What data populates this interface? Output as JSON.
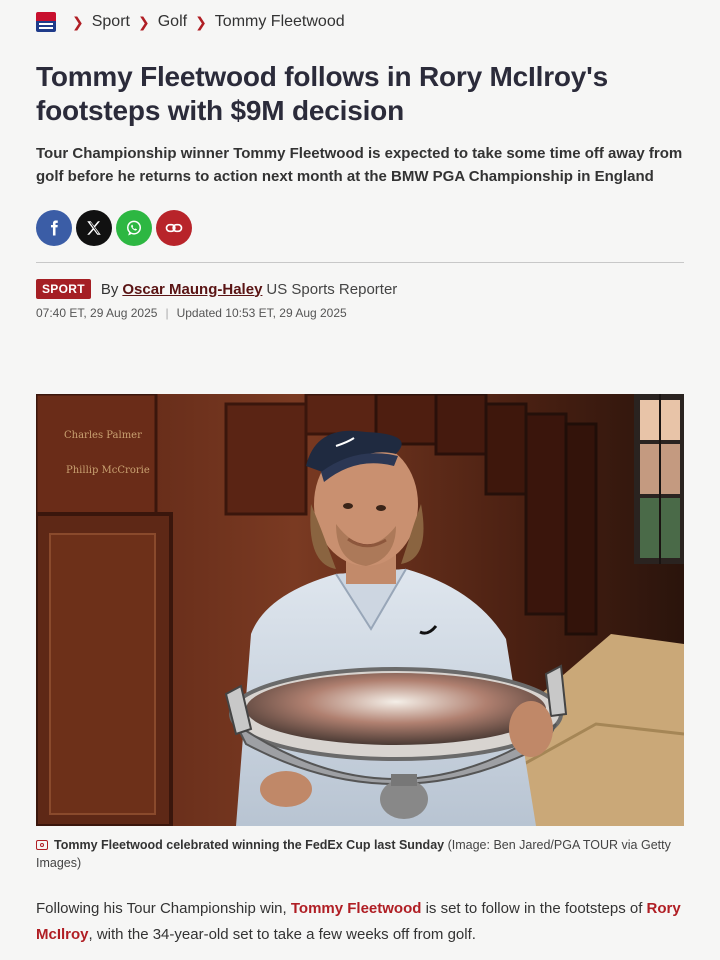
{
  "breadcrumb": {
    "logo": "publication-flag-logo",
    "items": [
      "Sport",
      "Golf",
      "Tommy Fleetwood"
    ]
  },
  "article": {
    "headline": "Tommy Fleetwood follows in Rory McIlroy's footsteps with $9M decision",
    "standfirst": "Tour Championship winner Tommy Fleetwood is expected to take some time off away from golf before he returns to action next month at the BMW PGA Championship in England",
    "section_badge": "SPORT",
    "by_prefix": "By",
    "author": "Oscar Maung-Haley",
    "author_role": "US Sports Reporter",
    "published": "07:40 ET, 29 Aug 2025",
    "updated": "Updated 10:53 ET, 29 Aug 2025"
  },
  "share": {
    "buttons": [
      "facebook-icon",
      "x-icon",
      "whatsapp-icon",
      "link-icon"
    ]
  },
  "photo": {
    "nameplates": [
      "Charles Palmer",
      "Phillip McCrorie"
    ]
  },
  "caption": {
    "main": "Tommy Fleetwood celebrated winning the FedEx Cup last Sunday",
    "credit": "(Image: Ben Jared/PGA TOUR via Getty Images)"
  },
  "body": {
    "p1_a": "Following his Tour Championship win, ",
    "p1_link1": "Tommy Fleetwood",
    "p1_b": " is set to follow in the footsteps of ",
    "p1_link2": "Rory McIlroy",
    "p1_c": ", with the 34-year-old set to take a few weeks off from golf."
  },
  "colors": {
    "accent": "#b01e24",
    "background": "#f6f6f5",
    "headline": "#2b2b3a"
  }
}
